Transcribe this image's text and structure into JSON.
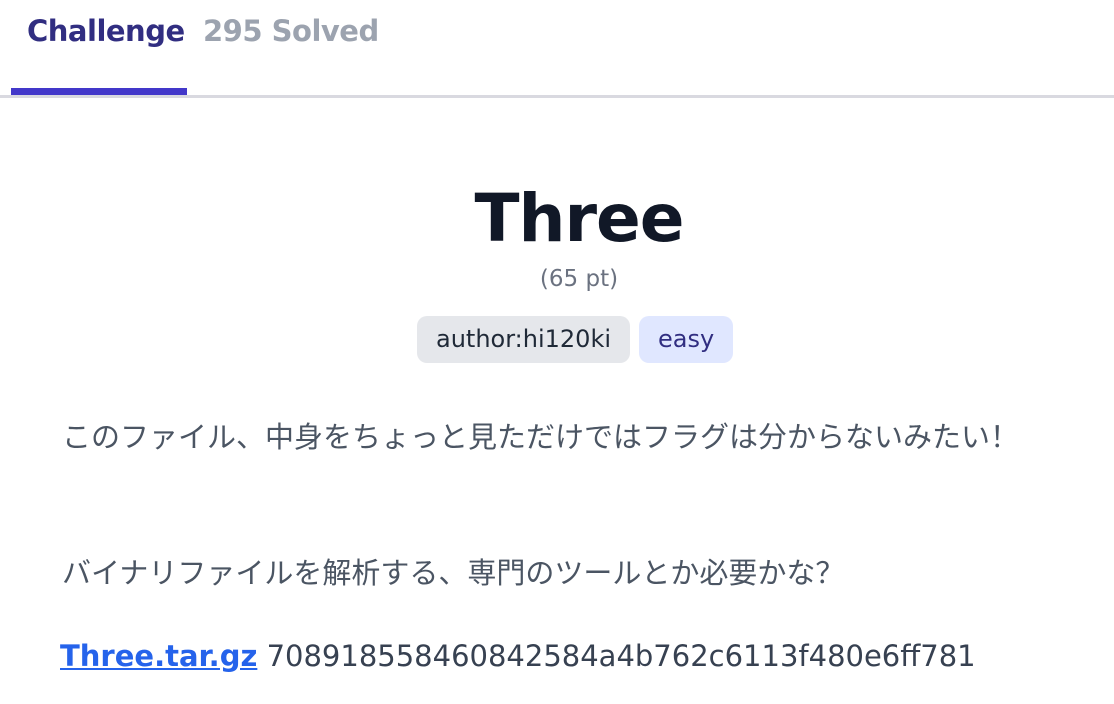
{
  "tabs": {
    "challenge_label": "Challenge",
    "solved_label": "295 Solved"
  },
  "challenge": {
    "title": "Three",
    "points": "(65 pt)",
    "tags": [
      "author:hi120ki",
      "easy"
    ],
    "description": [
      "このファイル、中身をちょっと見ただけではフラグは分からないみたい！",
      "バイナリファイルを解析する、専門のツールとか必要かな？"
    ],
    "file": {
      "name": "Three.tar.gz",
      "hash": "708918558460842584a4b762c6113f480e6ff781"
    }
  },
  "colors": {
    "accent": "#4338ca",
    "tab_active": "#312e81",
    "tab_inactive": "#9ca3af",
    "link": "#2563eb",
    "tag_author_bg": "#e5e7eb",
    "tag_easy_bg": "#e0e7ff"
  }
}
